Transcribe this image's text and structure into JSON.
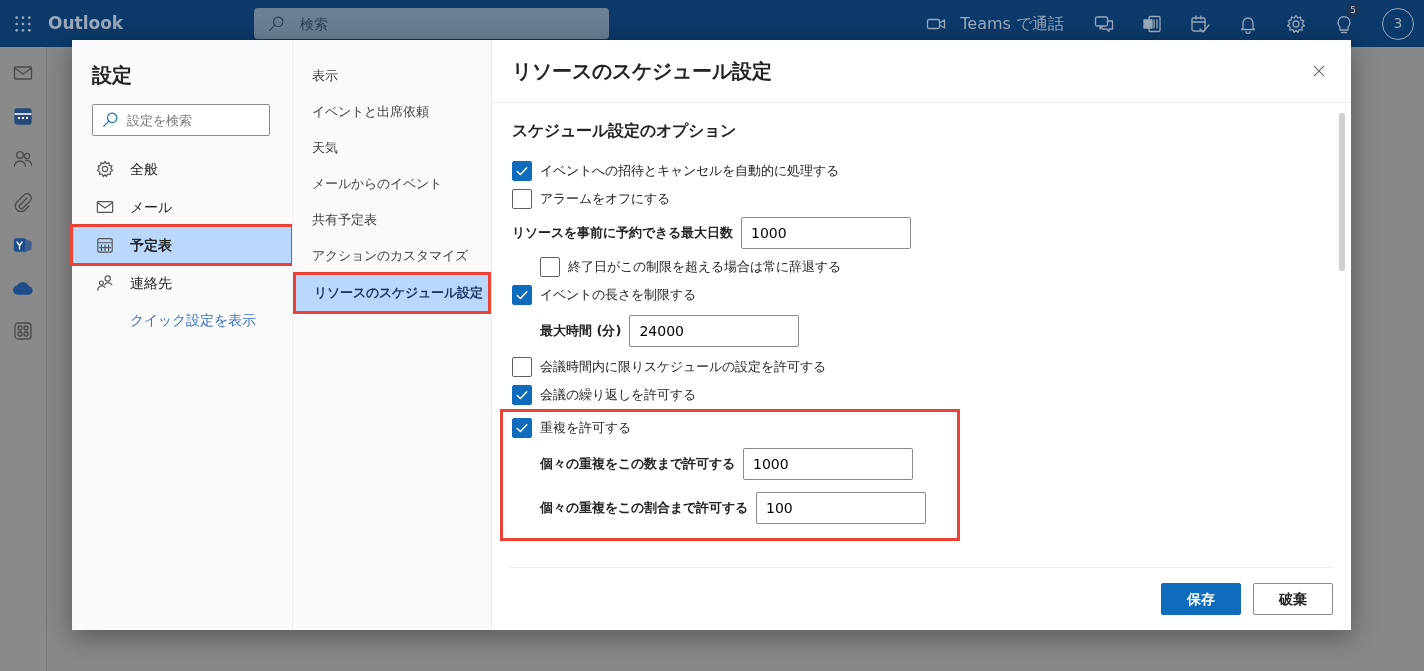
{
  "app": {
    "name": "Outlook",
    "search": {
      "placeholder": "検索"
    },
    "teams_call": "Teams で通話",
    "tips_badge": "5",
    "avatar": "3"
  },
  "settings": {
    "title": "設定",
    "search": {
      "placeholder": "設定を検索"
    },
    "categories": [
      {
        "label": "全般",
        "selected": false,
        "highlighted": false
      },
      {
        "label": "メール",
        "selected": false,
        "highlighted": false
      },
      {
        "label": "予定表",
        "selected": true,
        "highlighted": true
      },
      {
        "label": "連絡先",
        "selected": false,
        "highlighted": false
      }
    ],
    "quick_link": "クイック設定を表示",
    "subcategories": [
      {
        "label": "表示",
        "selected": false,
        "highlighted": false
      },
      {
        "label": "イベントと出席依頼",
        "selected": false,
        "highlighted": false
      },
      {
        "label": "天気",
        "selected": false,
        "highlighted": false
      },
      {
        "label": "メールからのイベント",
        "selected": false,
        "highlighted": false
      },
      {
        "label": "共有予定表",
        "selected": false,
        "highlighted": false
      },
      {
        "label": "アクションのカスタマイズ",
        "selected": false,
        "highlighted": false
      },
      {
        "label": "リソースのスケジュール設定",
        "selected": true,
        "highlighted": true
      }
    ]
  },
  "panel": {
    "title": "リソースのスケジュール設定",
    "section": "スケジュール設定のオプション",
    "options": [
      {
        "kind": "checkbox",
        "label": "イベントへの招待とキャンセルを自動的に処理する",
        "checked": true
      },
      {
        "kind": "checkbox",
        "label": "アラームをオフにする",
        "checked": false
      },
      {
        "kind": "number",
        "label": "リソースを事前に予約できる最大日数",
        "value": "1000",
        "children": [
          {
            "kind": "checkbox",
            "label": "終了日がこの制限を超える場合は常に辞退する",
            "checked": false
          }
        ]
      },
      {
        "kind": "checkbox",
        "label": "イベントの長さを制限する",
        "checked": true,
        "children": [
          {
            "kind": "number",
            "label": "最大時間 (分)",
            "value": "24000"
          }
        ]
      },
      {
        "kind": "checkbox",
        "label": "会議時間内に限りスケジュールの設定を許可する",
        "checked": false
      },
      {
        "kind": "checkbox",
        "label": "会議の繰り返しを許可する",
        "checked": true
      },
      {
        "kind": "checkbox",
        "label": "重複を許可する",
        "checked": true,
        "highlighted": true,
        "children": [
          {
            "kind": "number",
            "label": "個々の重複をこの数まで許可する",
            "value": "1000"
          },
          {
            "kind": "number",
            "label": "個々の重複をこの割合まで許可する",
            "value": "100"
          }
        ]
      }
    ],
    "buttons": [
      {
        "label": "保存",
        "kind": "primary"
      },
      {
        "label": "破棄",
        "kind": "secondary"
      }
    ]
  }
}
